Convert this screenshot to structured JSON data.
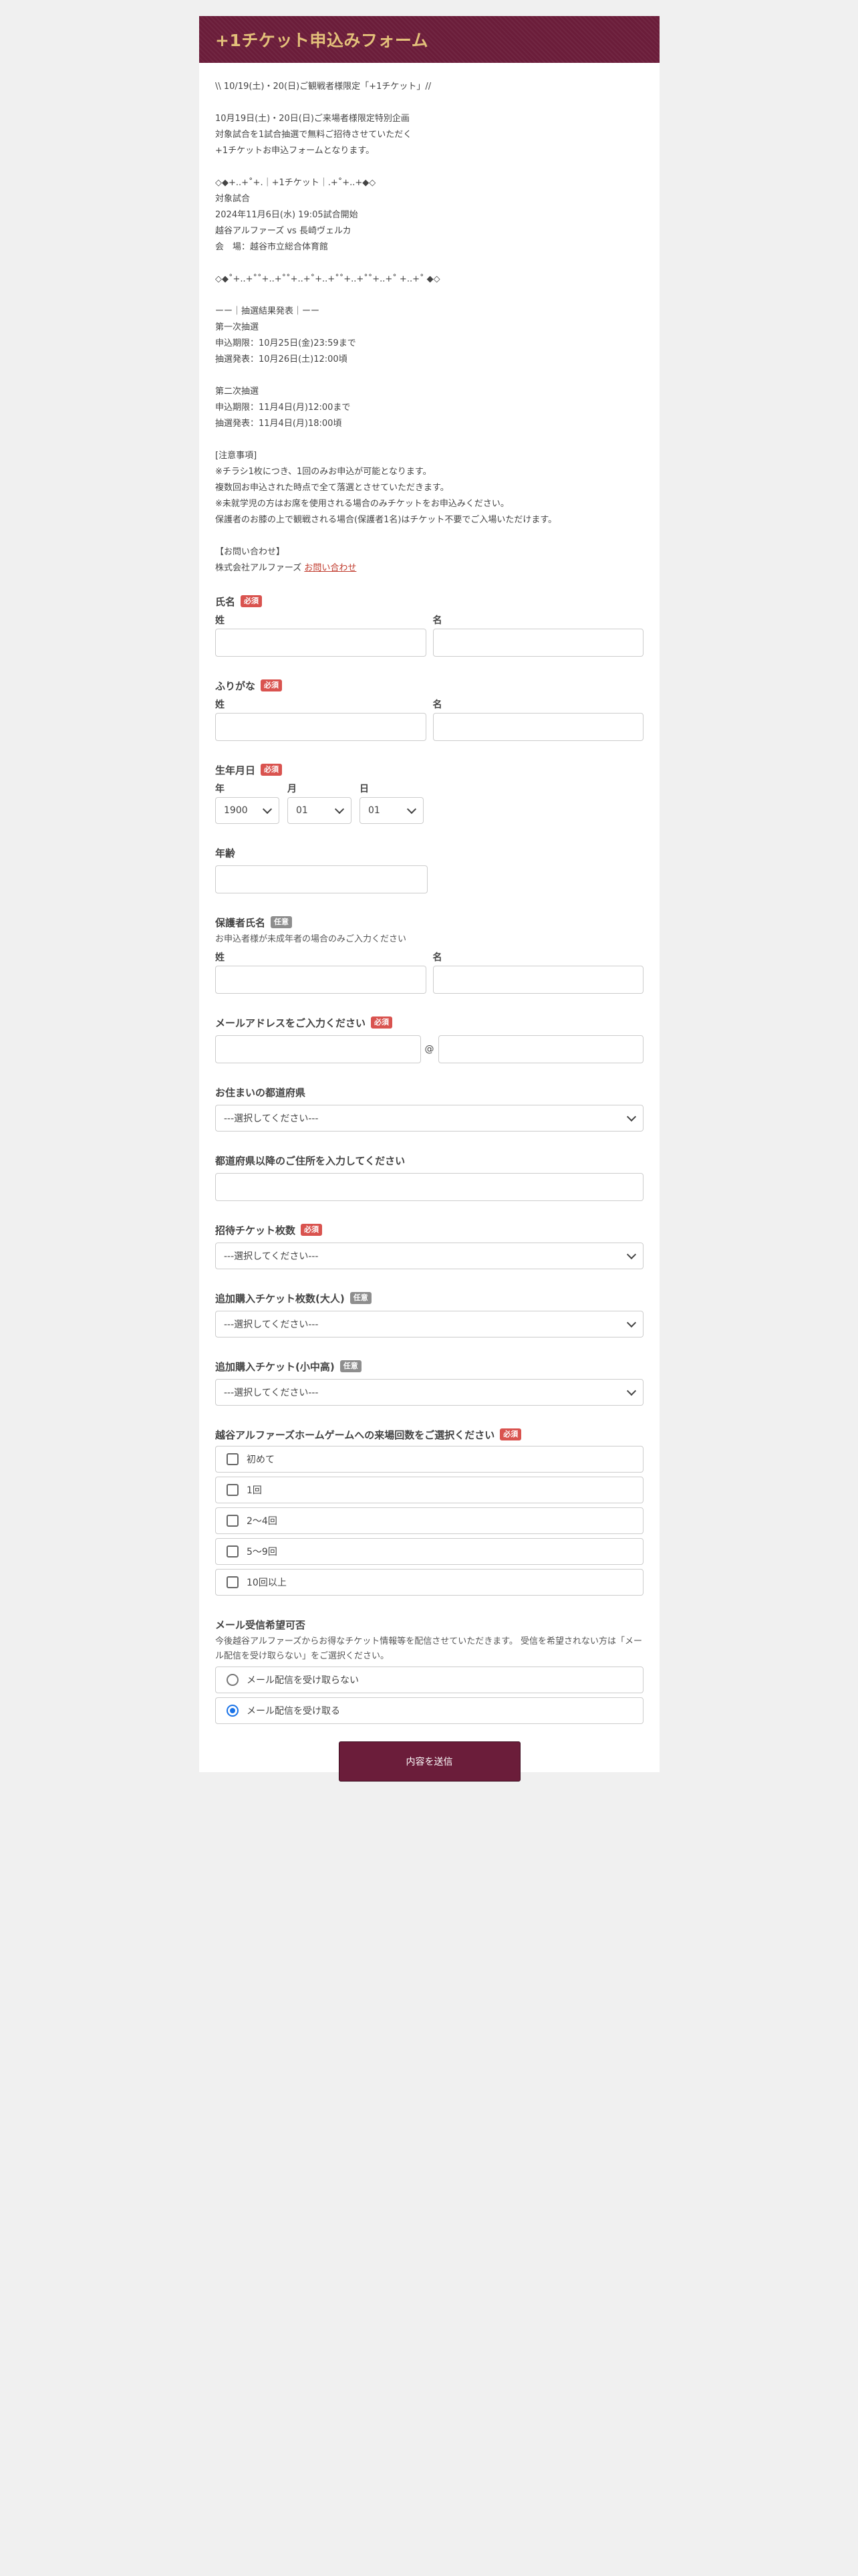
{
  "header": {
    "title": "+1チケット申込みフォーム"
  },
  "intro": {
    "lines": [
      "\\\\ 10/19(土)・20(日)ご観戦者様限定「+1チケット」//",
      "",
      "10月19日(土)・20日(日)ご来場者様限定特別企画",
      "対象試合を1試合抽選で無料ご招待させていただく",
      "+1チケットお申込フォームとなります。",
      "",
      "◇◆+..+˚+.｜+1チケット｜.+˚+..+◆◇",
      "対象試合",
      "2024年11月6日(水) 19:05試合開始",
      "越谷アルファーズ vs 長崎ヴェルカ",
      "会　場：越谷市立総合体育館",
      "",
      "◇◆˚+..+˚˚+..+˚˚+..+˚+..+˚˚+..+˚˚+..+˚ +..+˚ ◆◇",
      "",
      "ーー｜抽選結果発表｜ーー",
      "第一次抽選",
      "申込期限：10月25日(金)23:59まで",
      "抽選発表：10月26日(土)12:00頃",
      "",
      "第二次抽選",
      "申込期限：11月4日(月)12:00まで",
      "抽選発表：11月4日(月)18:00頃",
      "",
      "[注意事項]",
      "※チラシ1枚につき、1回のみお申込が可能となります。",
      "複数回お申込された時点で全て落選とさせていただきます。",
      "※未就学児の方はお席を使用される場合のみチケットをお申込みください。",
      "保護者のお膝の上で観戦される場合(保護者1名)はチケット不要でご入場いただけます。",
      "",
      "【お問い合わせ】"
    ],
    "contact_prefix": "株式会社アルファーズ ",
    "contact_link": "お問い合わせ"
  },
  "badges": {
    "required": "必須",
    "optional": "任意"
  },
  "fields": {
    "name": {
      "label": "氏名",
      "last": "姓",
      "first": "名"
    },
    "kana": {
      "label": "ふりがな",
      "last": "姓",
      "first": "名"
    },
    "dob": {
      "label": "生年月日",
      "year_label": "年",
      "month_label": "月",
      "day_label": "日",
      "year": "1900",
      "month": "01",
      "day": "01"
    },
    "age": {
      "label": "年齢"
    },
    "guardian": {
      "label": "保護者氏名",
      "note": "お申込者様が未成年者の場合のみご入力ください",
      "last": "姓",
      "first": "名"
    },
    "email": {
      "label": "メールアドレスをご入力ください",
      "at": "@"
    },
    "prefecture": {
      "label": "お住まいの都道府県",
      "value": "---選択してください---"
    },
    "address": {
      "label": "都道府県以降のご住所を入力してください"
    },
    "tickets": {
      "label": "招待チケット枚数",
      "value": "---選択してください---"
    },
    "extra_adult": {
      "label": "追加購入チケット枚数(大人)",
      "value": "---選択してください---"
    },
    "extra_child": {
      "label": "追加購入チケット(小中高)",
      "value": "---選択してください---"
    },
    "visits": {
      "label": "越谷アルファーズホームゲームへの来場回数をご選択ください",
      "options": [
        "初めて",
        "1回",
        "2〜4回",
        "5〜9回",
        "10回以上"
      ]
    },
    "mail": {
      "label": "メール受信希望可否",
      "note": "今後越谷アルファーズからお得なチケット情報等を配信させていただきます。 受信を希望されない方は「メール配信を受け取らない」をご選択ください。",
      "options": [
        "メール配信を受け取らない",
        "メール配信を受け取る"
      ],
      "selected_index": 1
    }
  },
  "submit": {
    "label": "内容を送信"
  }
}
